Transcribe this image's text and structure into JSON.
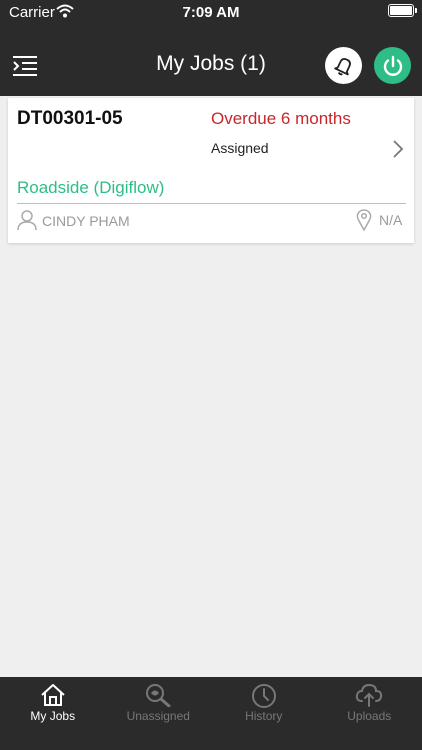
{
  "status_bar": {
    "carrier": "Carrier",
    "time": "7:09 AM"
  },
  "nav": {
    "title": "My Jobs (1)"
  },
  "jobs": [
    {
      "id": "DT00301-05",
      "due": "Overdue 6 months",
      "status": "Assigned",
      "type": "Roadside (Digiflow)",
      "person": "CINDY PHAM",
      "location": "N/A"
    }
  ],
  "tabs": [
    {
      "label": "My Jobs",
      "icon": "home-icon",
      "active": true
    },
    {
      "label": "Unassigned",
      "icon": "search-icon",
      "active": false
    },
    {
      "label": "History",
      "icon": "clock-icon",
      "active": false
    },
    {
      "label": "Uploads",
      "icon": "cloud-upload-icon",
      "active": false
    }
  ],
  "colors": {
    "accent": "#2ebd86",
    "overdue": "#c9262c",
    "bar": "#2b2b2b",
    "background": "#efefef"
  }
}
